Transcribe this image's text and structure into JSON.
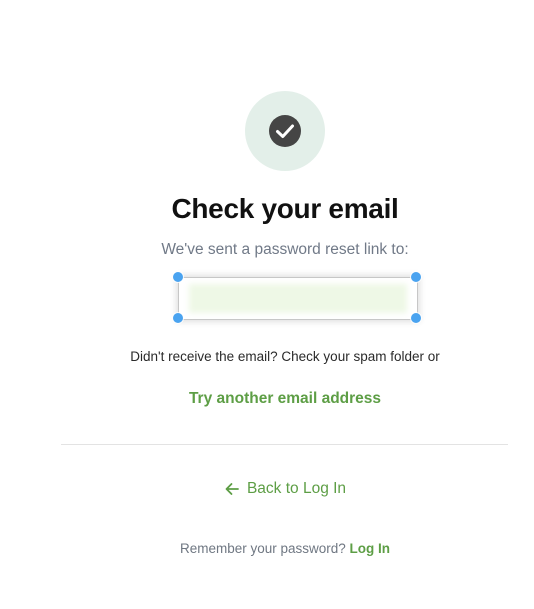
{
  "badge": {
    "icon": "check-circle-icon",
    "bg_color": "#e3efe9",
    "icon_color": "#454545"
  },
  "title": "Check your email",
  "subtitle": "We've sent a password reset link to:",
  "email": {
    "value": ""
  },
  "info_text": "Didn't receive the email? Check your spam folder or",
  "try_another_link": "Try another email address",
  "back_link": {
    "icon": "arrow-left-icon",
    "label": "Back to Log In"
  },
  "remember": {
    "text": "Remember your password?",
    "link": "Log In"
  },
  "colors": {
    "accent": "#5d9e45",
    "handle": "#4aa3f0",
    "text_dark": "#111111",
    "text_muted": "#6f7782"
  }
}
